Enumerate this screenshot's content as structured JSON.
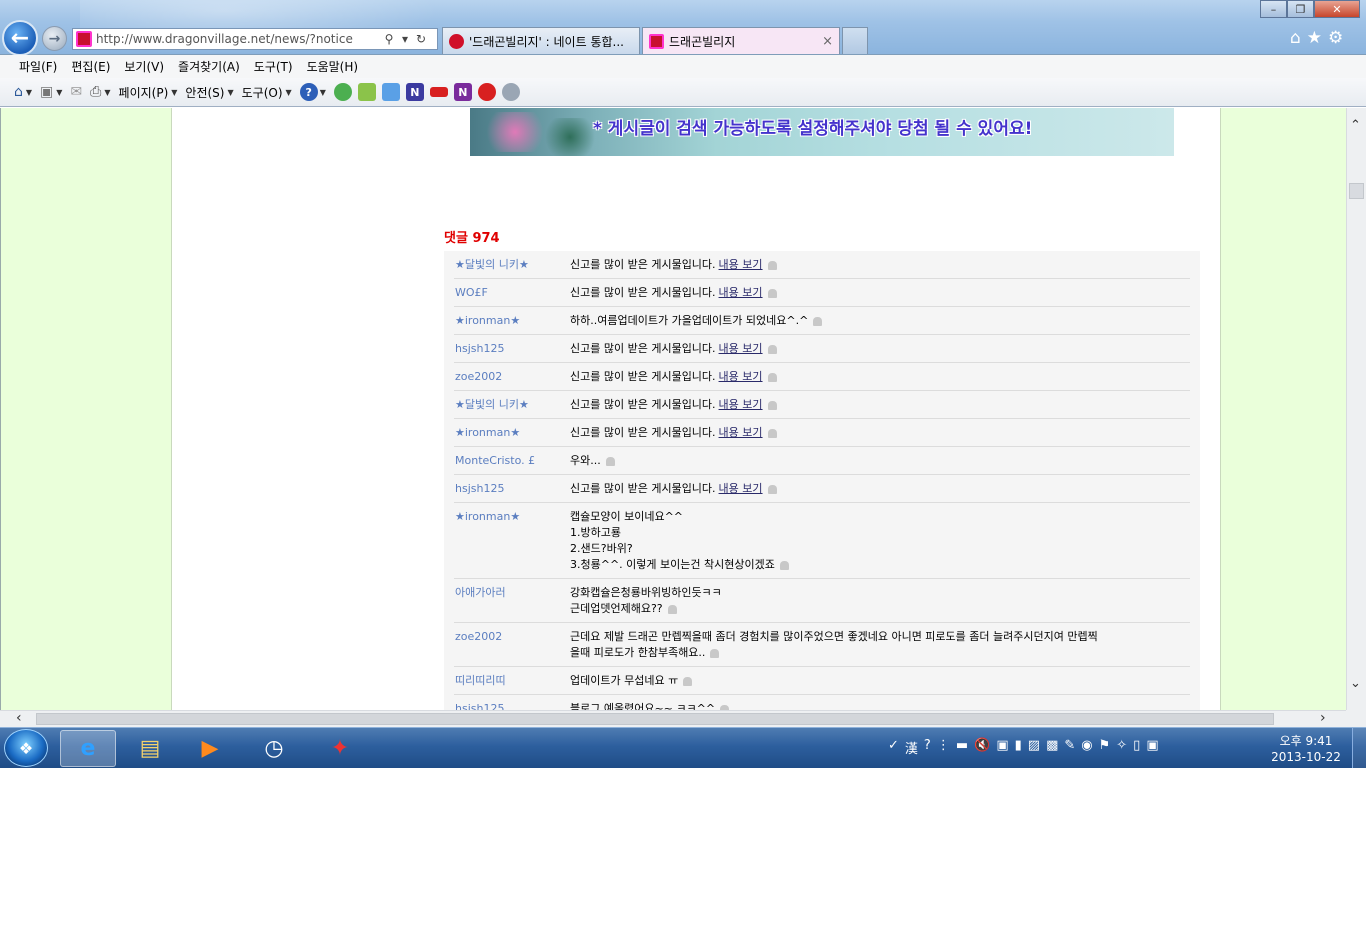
{
  "browser": {
    "address": "http://www.dragonvillage.net/news/?notice",
    "tabs": [
      {
        "label": "'드래곤빌리지' : 네이트 통합..."
      },
      {
        "label": "드래곤빌리지"
      }
    ],
    "tab_close_glyph": "×"
  },
  "menubar": {
    "items": [
      "파일(F)",
      "편집(E)",
      "보기(V)",
      "즐겨찾기(A)",
      "도구(T)",
      "도움말(H)"
    ]
  },
  "commandbar": {
    "page_label": "페이지(P)",
    "safety_label": "안전(S)",
    "tools_label": "도구(O)"
  },
  "banner": {
    "text": "* 게시글이 검색 가능하도록 설정해주셔야 당첨 될 수 있어요!"
  },
  "comments": {
    "heading": "댓글 974",
    "link_label": "내용 보기",
    "items": [
      {
        "author": "★달빛의 니키★",
        "lines": [
          "신고를 많이 받은 게시물입니다."
        ],
        "has_link": true
      },
      {
        "author": "WO£F",
        "lines": [
          "신고를 많이 받은 게시물입니다."
        ],
        "has_link": true
      },
      {
        "author": "★ironman★",
        "lines": [
          "하하..여름업데이트가 가을업데이트가 되었네요^.^"
        ],
        "has_link": false
      },
      {
        "author": "hsjsh125",
        "lines": [
          "신고를 많이 받은 게시물입니다."
        ],
        "has_link": true
      },
      {
        "author": "zoe2002",
        "lines": [
          "신고를 많이 받은 게시물입니다."
        ],
        "has_link": true
      },
      {
        "author": "★달빛의 니키★",
        "lines": [
          "신고를 많이 받은 게시물입니다."
        ],
        "has_link": true
      },
      {
        "author": "★ironman★",
        "lines": [
          "신고를 많이 받은 게시물입니다."
        ],
        "has_link": true
      },
      {
        "author": "MonteCristo. £",
        "lines": [
          "우와..."
        ],
        "has_link": false
      },
      {
        "author": "hsjsh125",
        "lines": [
          "신고를 많이 받은 게시물입니다."
        ],
        "has_link": true
      },
      {
        "author": "★ironman★",
        "lines": [
          "캡슐모양이 보이네요^^",
          "1.방하고룡",
          "2.샌드?바위?",
          "3.청룡^^. 이렇게 보이는건 착시현상이겠죠"
        ],
        "has_link": false
      },
      {
        "author": "아애가아러",
        "lines": [
          "강화캡슐은청룡바위빙하인듯ㅋㅋ",
          "근데업뎃언제해요??"
        ],
        "has_link": false
      },
      {
        "author": "zoe2002",
        "lines": [
          "근데요 제발 드래곤 만렙찍을때 좀더 경험치를 많이주었으면 좋겠네요 아니면 피로도를 좀더 늘려주시던지여 만렙찍",
          "을때 피로도가 한참부족해요.."
        ],
        "has_link": false
      },
      {
        "author": "띠리띠리띠",
        "lines": [
          "업데이트가 무섭네요 ㅠ"
        ],
        "has_link": false
      },
      {
        "author": "hsjsh125",
        "lines": [
          "블로그 예올렸어요~~ ㅋㅋ^^"
        ],
        "has_link": false
      }
    ]
  },
  "taskbar": {
    "time": "오후 9:41",
    "date": "2013-10-22"
  },
  "colors": {
    "side_panel": "#eaffda",
    "comment_heading": "#e00000",
    "author_link": "#5b7ec0",
    "banner_text": "#4433cc"
  },
  "icons": {
    "back": "back-arrow-icon",
    "forward": "forward-arrow-icon",
    "home": "home-icon",
    "favorites": "star-icon",
    "tools": "gear-icon"
  }
}
